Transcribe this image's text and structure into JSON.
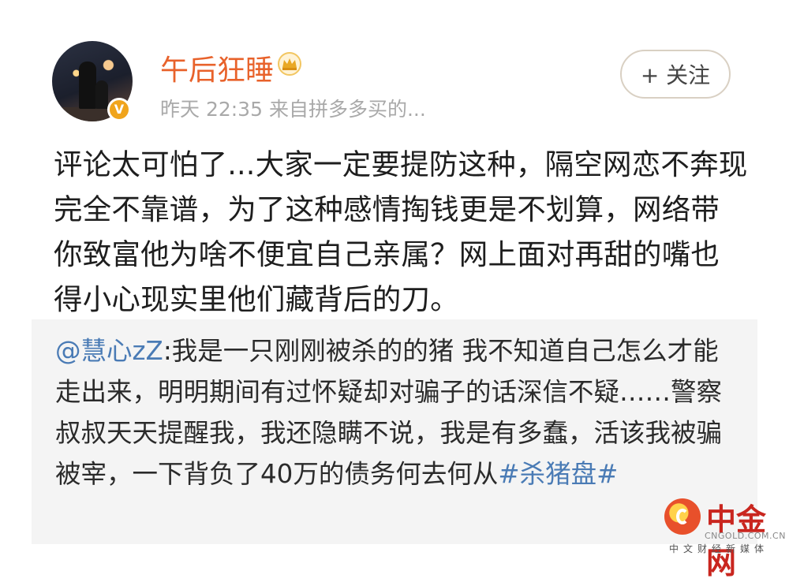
{
  "post": {
    "username": "午后狂睡",
    "verified_badge": "V",
    "meta": "昨天 22:35  来自拼多多买的...",
    "follow_label": "+ 关注",
    "text": "评论太可怕了...大家一定要提防这种，隔空网恋不奔现完全不靠谱，为了这种感情掏钱更是不划算，网络带你致富他为啥不便宜自己亲属？网上面对再甜的嘴也得小心现实里他们藏背后的刀。"
  },
  "repost": {
    "mention": "@慧心zZ",
    "body": ":我是一只刚刚被杀的的猪 我不知道自己怎么才能走出来，明明期间有过怀疑却对骗子的话深信不疑……警察叔叔天天提醒我，我还隐瞒不说，我是有多蠢，活该我被骗被宰，一下背负了40万的债务何去何从",
    "hashtag": "#杀猪盘#"
  },
  "watermark": {
    "name": "中金网",
    "url": "CNGOLD.COM.CN",
    "subtitle": "中文财经新媒体"
  },
  "colors": {
    "username": "#e8622b",
    "link": "#4a7bb5",
    "repost_bg": "#f4f4f4",
    "watermark": "#c9261f"
  },
  "icons": [
    "avatar",
    "verified-badge-icon",
    "crown-icon",
    "watermark-logo-icon"
  ]
}
